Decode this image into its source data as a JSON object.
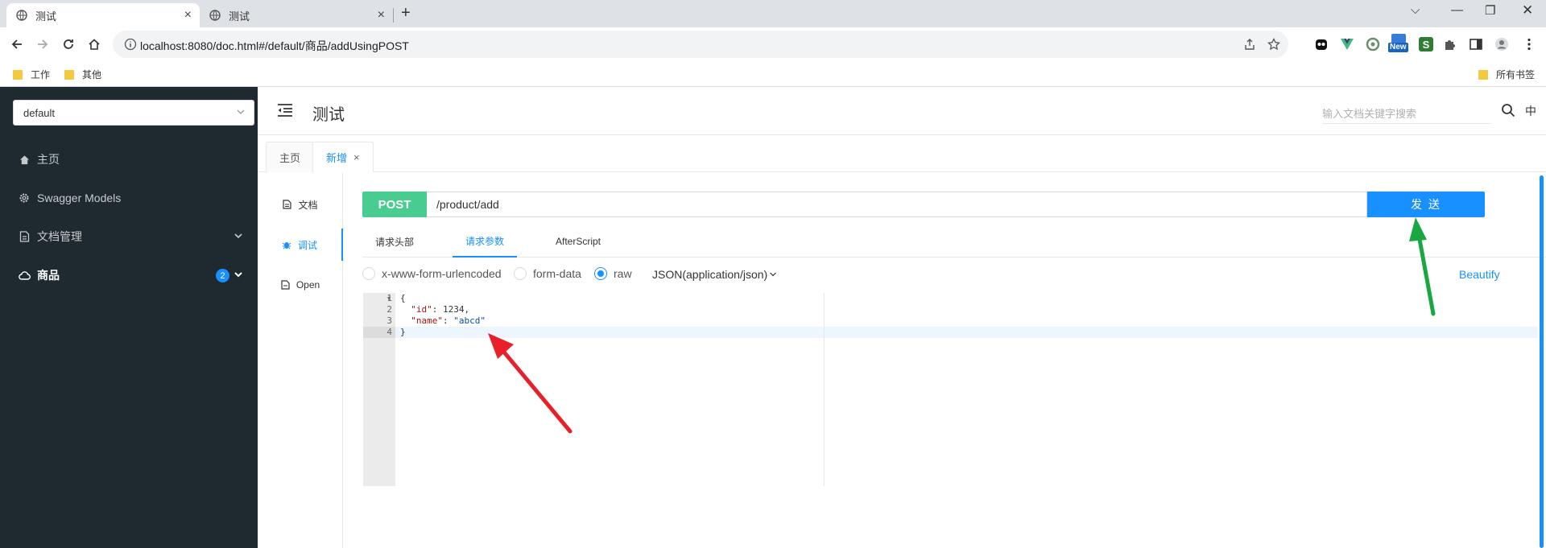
{
  "browser": {
    "tabs": [
      {
        "title": "测试",
        "active": true
      },
      {
        "title": "测试",
        "active": false
      }
    ],
    "url": "localhost:8080/doc.html#/default/商品/addUsingPOST",
    "bookmarks": [
      "工作",
      "其他"
    ],
    "all_bookmarks": "所有书签",
    "new_badge": "New",
    "ext_s": "S"
  },
  "sidebar": {
    "group": "default",
    "items": [
      {
        "label": "主页",
        "icon": "home-icon"
      },
      {
        "label": "Swagger Models",
        "icon": "gear-icon"
      },
      {
        "label": "文档管理",
        "icon": "doc-icon"
      },
      {
        "label": "商品",
        "icon": "cloud-icon",
        "badge": "2"
      }
    ]
  },
  "header": {
    "title": "测试",
    "search_placeholder": "输入文档关键字搜索",
    "lang": "中"
  },
  "page_tabs": [
    {
      "label": "主页"
    },
    {
      "label": "新增",
      "close": "×"
    }
  ],
  "side_tabs": [
    {
      "label": "文档"
    },
    {
      "label": "调试"
    },
    {
      "label": "Open"
    }
  ],
  "request": {
    "method": "POST",
    "path": "/product/add",
    "send_label": "发 送"
  },
  "sub_tabs": [
    "请求头部",
    "请求参数",
    "AfterScript"
  ],
  "body_types": [
    "x-www-form-urlencoded",
    "form-data",
    "raw"
  ],
  "content_type": "JSON(application/json)",
  "beautify": "Beautify",
  "editor": {
    "line_numbers": [
      "1",
      "2",
      "3",
      "4"
    ],
    "line1": "{",
    "key_id": "\"id\"",
    "val_id": ": 1234,",
    "key_name": "\"name\"",
    "colon": ": ",
    "val_name": "\"abcd\"",
    "line4": "}"
  }
}
